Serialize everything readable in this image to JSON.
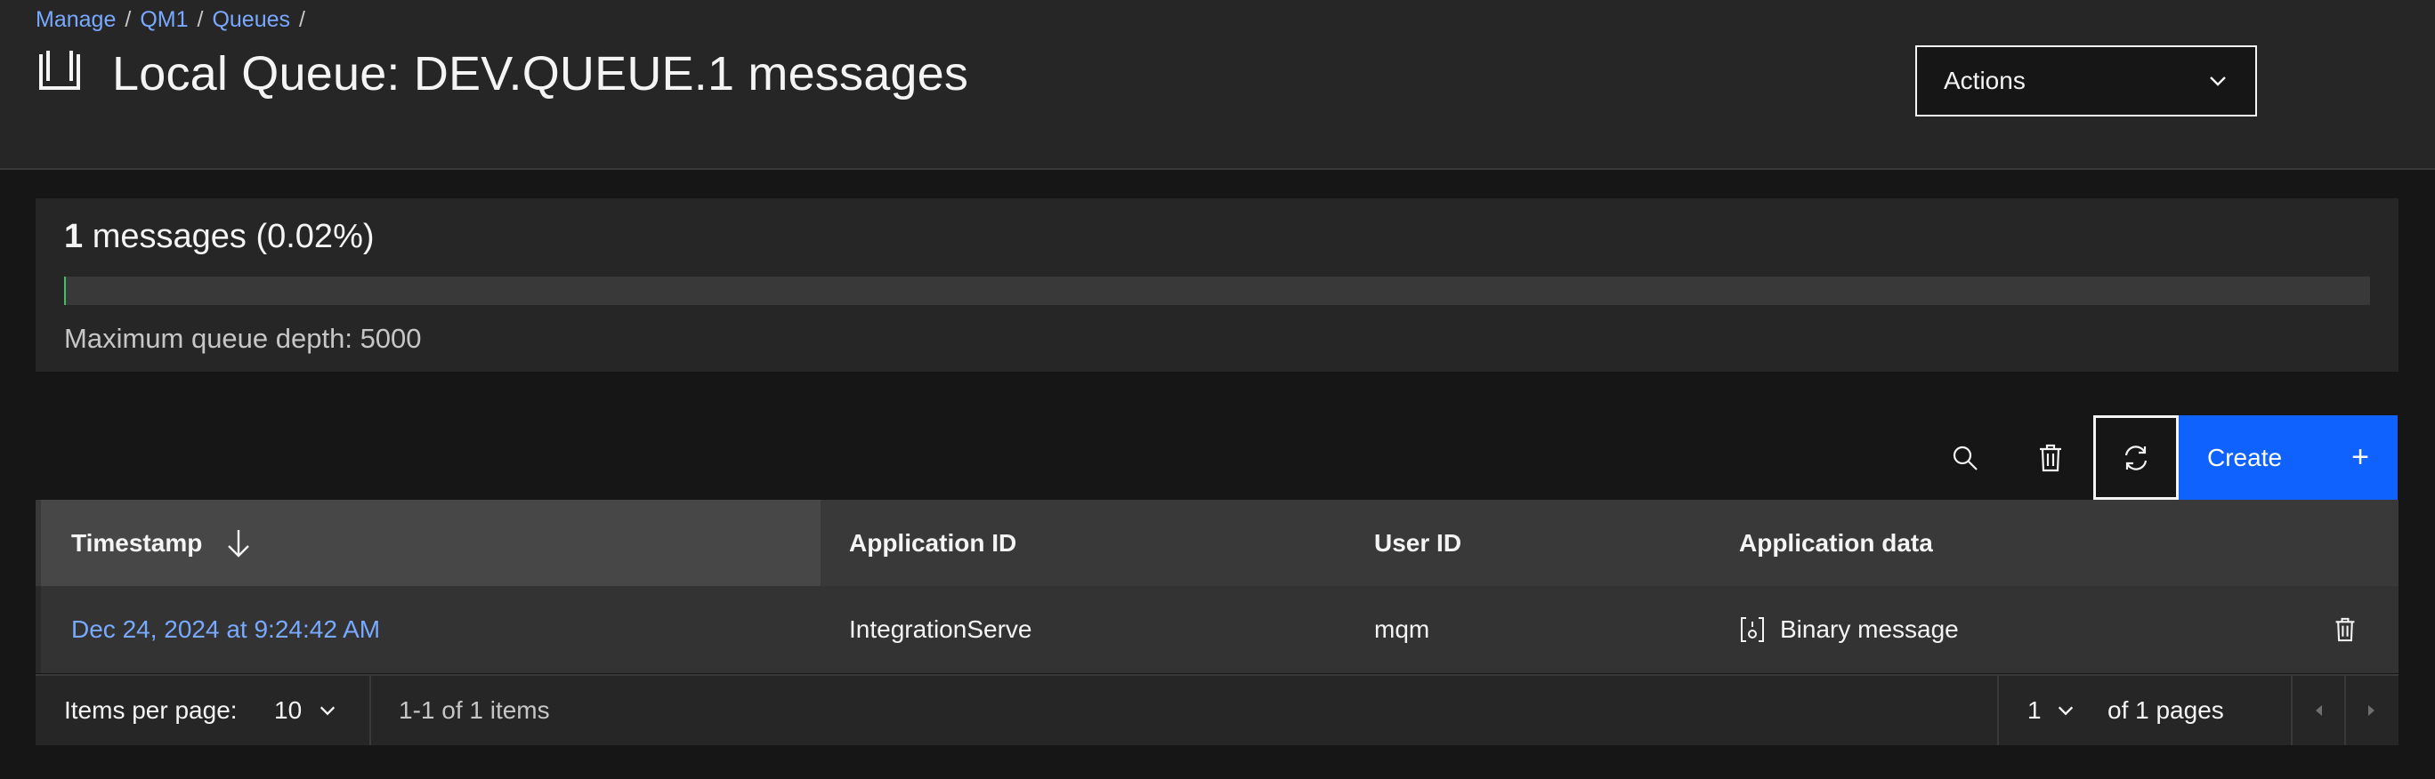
{
  "breadcrumb": {
    "items": [
      "Manage",
      "QM1",
      "Queues"
    ],
    "separator": "/"
  },
  "header": {
    "title": "Local Queue: DEV.QUEUE.1 messages",
    "icon": "queue-icon",
    "actions_label": "Actions"
  },
  "depth": {
    "count": "1",
    "count_suffix": "messages (0.02%)",
    "percent": 0.02,
    "max_label": "Maximum queue depth: 5000",
    "fill_color": "#42be65"
  },
  "toolbar": {
    "search_icon": "search-icon",
    "delete_icon": "trash-icon",
    "refresh_icon": "refresh-icon",
    "create_label": "Create",
    "create_icon": "+"
  },
  "table": {
    "columns": [
      "Timestamp",
      "Application ID",
      "User ID",
      "Application data"
    ],
    "sort_icon": "arrow-down-icon",
    "rows": [
      {
        "timestamp": "Dec 24, 2024 at 9:24:42 AM",
        "application_id": "IntegrationServe",
        "user_id": "mqm",
        "application_data": "Binary message",
        "data_icon": "binary-icon",
        "delete_icon": "trash-icon"
      }
    ]
  },
  "pagination": {
    "items_per_page_label": "Items per page:",
    "items_per_page": "10",
    "range": "1-1 of 1 items",
    "page": "1",
    "of_pages": "of 1 pages"
  },
  "colors": {
    "background": "#161616",
    "header": "#262626",
    "accent": "#0f62fe",
    "link": "#78a9ff"
  }
}
